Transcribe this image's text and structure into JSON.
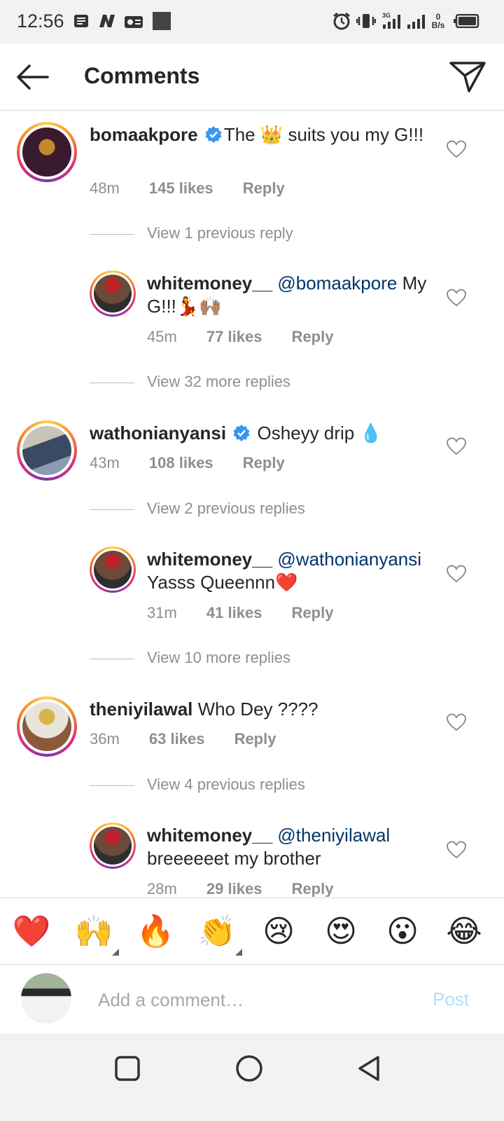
{
  "status_bar": {
    "time": "12:56",
    "net_speed_top": "0",
    "net_speed_unit": "B/s",
    "net_type": "3G"
  },
  "header": {
    "title": "Comments"
  },
  "comments": [
    {
      "username": "bomaakpore",
      "text_before_emoji": "The ",
      "emoji": "👑",
      "text_after_emoji": " suits you my G!!!",
      "time": "48m",
      "likes": "145 likes",
      "reply": "Reply"
    },
    {
      "username": "whitemoney__",
      "mention": "@bomaakpore",
      "text": " My G!!!💃🙌🏽",
      "time": "45m",
      "likes": "77 likes",
      "reply": "Reply"
    },
    {
      "username": "wathonianyansi",
      "text": " Osheyy drip 💧",
      "time": "43m",
      "likes": "108 likes",
      "reply": "Reply"
    },
    {
      "username": "whitemoney__",
      "mention": "@wathonianyansi",
      "text": " Yasss Queennn❤️",
      "time": "31m",
      "likes": "41 likes",
      "reply": "Reply"
    },
    {
      "username": "theniyilawal",
      "text": " Who Dey ????",
      "time": "36m",
      "likes": "63 likes",
      "reply": "Reply"
    },
    {
      "username": "whitemoney__",
      "mention": "@theniyilawal",
      "text": " breeeeeet my brother",
      "time": "28m",
      "likes": "29 likes",
      "reply": "Reply"
    }
  ],
  "view_replies": [
    "View 1 previous reply",
    "View 32 more replies",
    "View 2 previous replies",
    "View 10 more replies",
    "View 4 previous replies"
  ],
  "reactions": [
    "❤️",
    "🙌",
    "🔥",
    "👏",
    "😢",
    "😍",
    "😮",
    "😂"
  ],
  "add_comment": {
    "placeholder": "Add a comment…",
    "post_label": "Post"
  },
  "colors": {
    "mention": "#003569",
    "meta": "#8e8e8e",
    "post_disabled": "#b2dffc",
    "verified": "#3897f0"
  }
}
